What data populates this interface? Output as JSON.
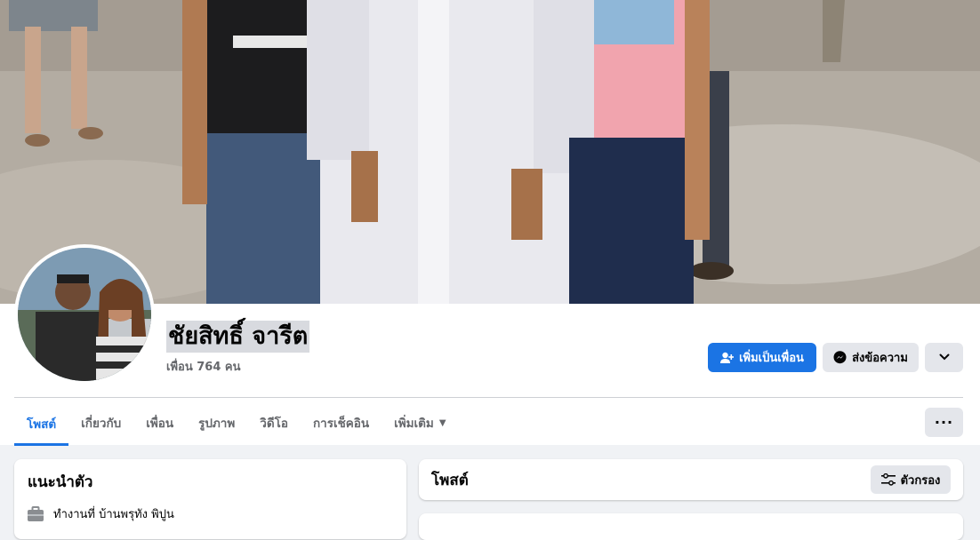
{
  "profile": {
    "name": "ชัยสิทธิ์ จารีต",
    "friends_text": "เพื่อน 764 คน"
  },
  "actions": {
    "add_friend_label": "เพิ่มเป็นเพื่อน",
    "message_label": "ส่งข้อความ"
  },
  "tabs": [
    {
      "label": "โพสต์",
      "active": true
    },
    {
      "label": "เกี่ยวกับ",
      "active": false
    },
    {
      "label": "เพื่อน",
      "active": false
    },
    {
      "label": "รูปภาพ",
      "active": false
    },
    {
      "label": "วิดีโอ",
      "active": false
    },
    {
      "label": "การเช็คอิน",
      "active": false
    },
    {
      "label": "เพิ่มเติม",
      "active": false
    }
  ],
  "intro": {
    "title": "แนะนำตัว",
    "work": "ทำงานที่ บ้านพรุทัง พิปูน"
  },
  "posts": {
    "title": "โพสต์",
    "filter_label": "ตัวกรอง"
  },
  "colors": {
    "accent": "#1b74e4",
    "background": "#f0f2f5",
    "secondary_button": "#e4e6eb"
  },
  "icons": [
    "add-friend-icon",
    "messenger-icon",
    "chevron-down-icon",
    "more-icon",
    "briefcase-icon",
    "filter-icon"
  ]
}
